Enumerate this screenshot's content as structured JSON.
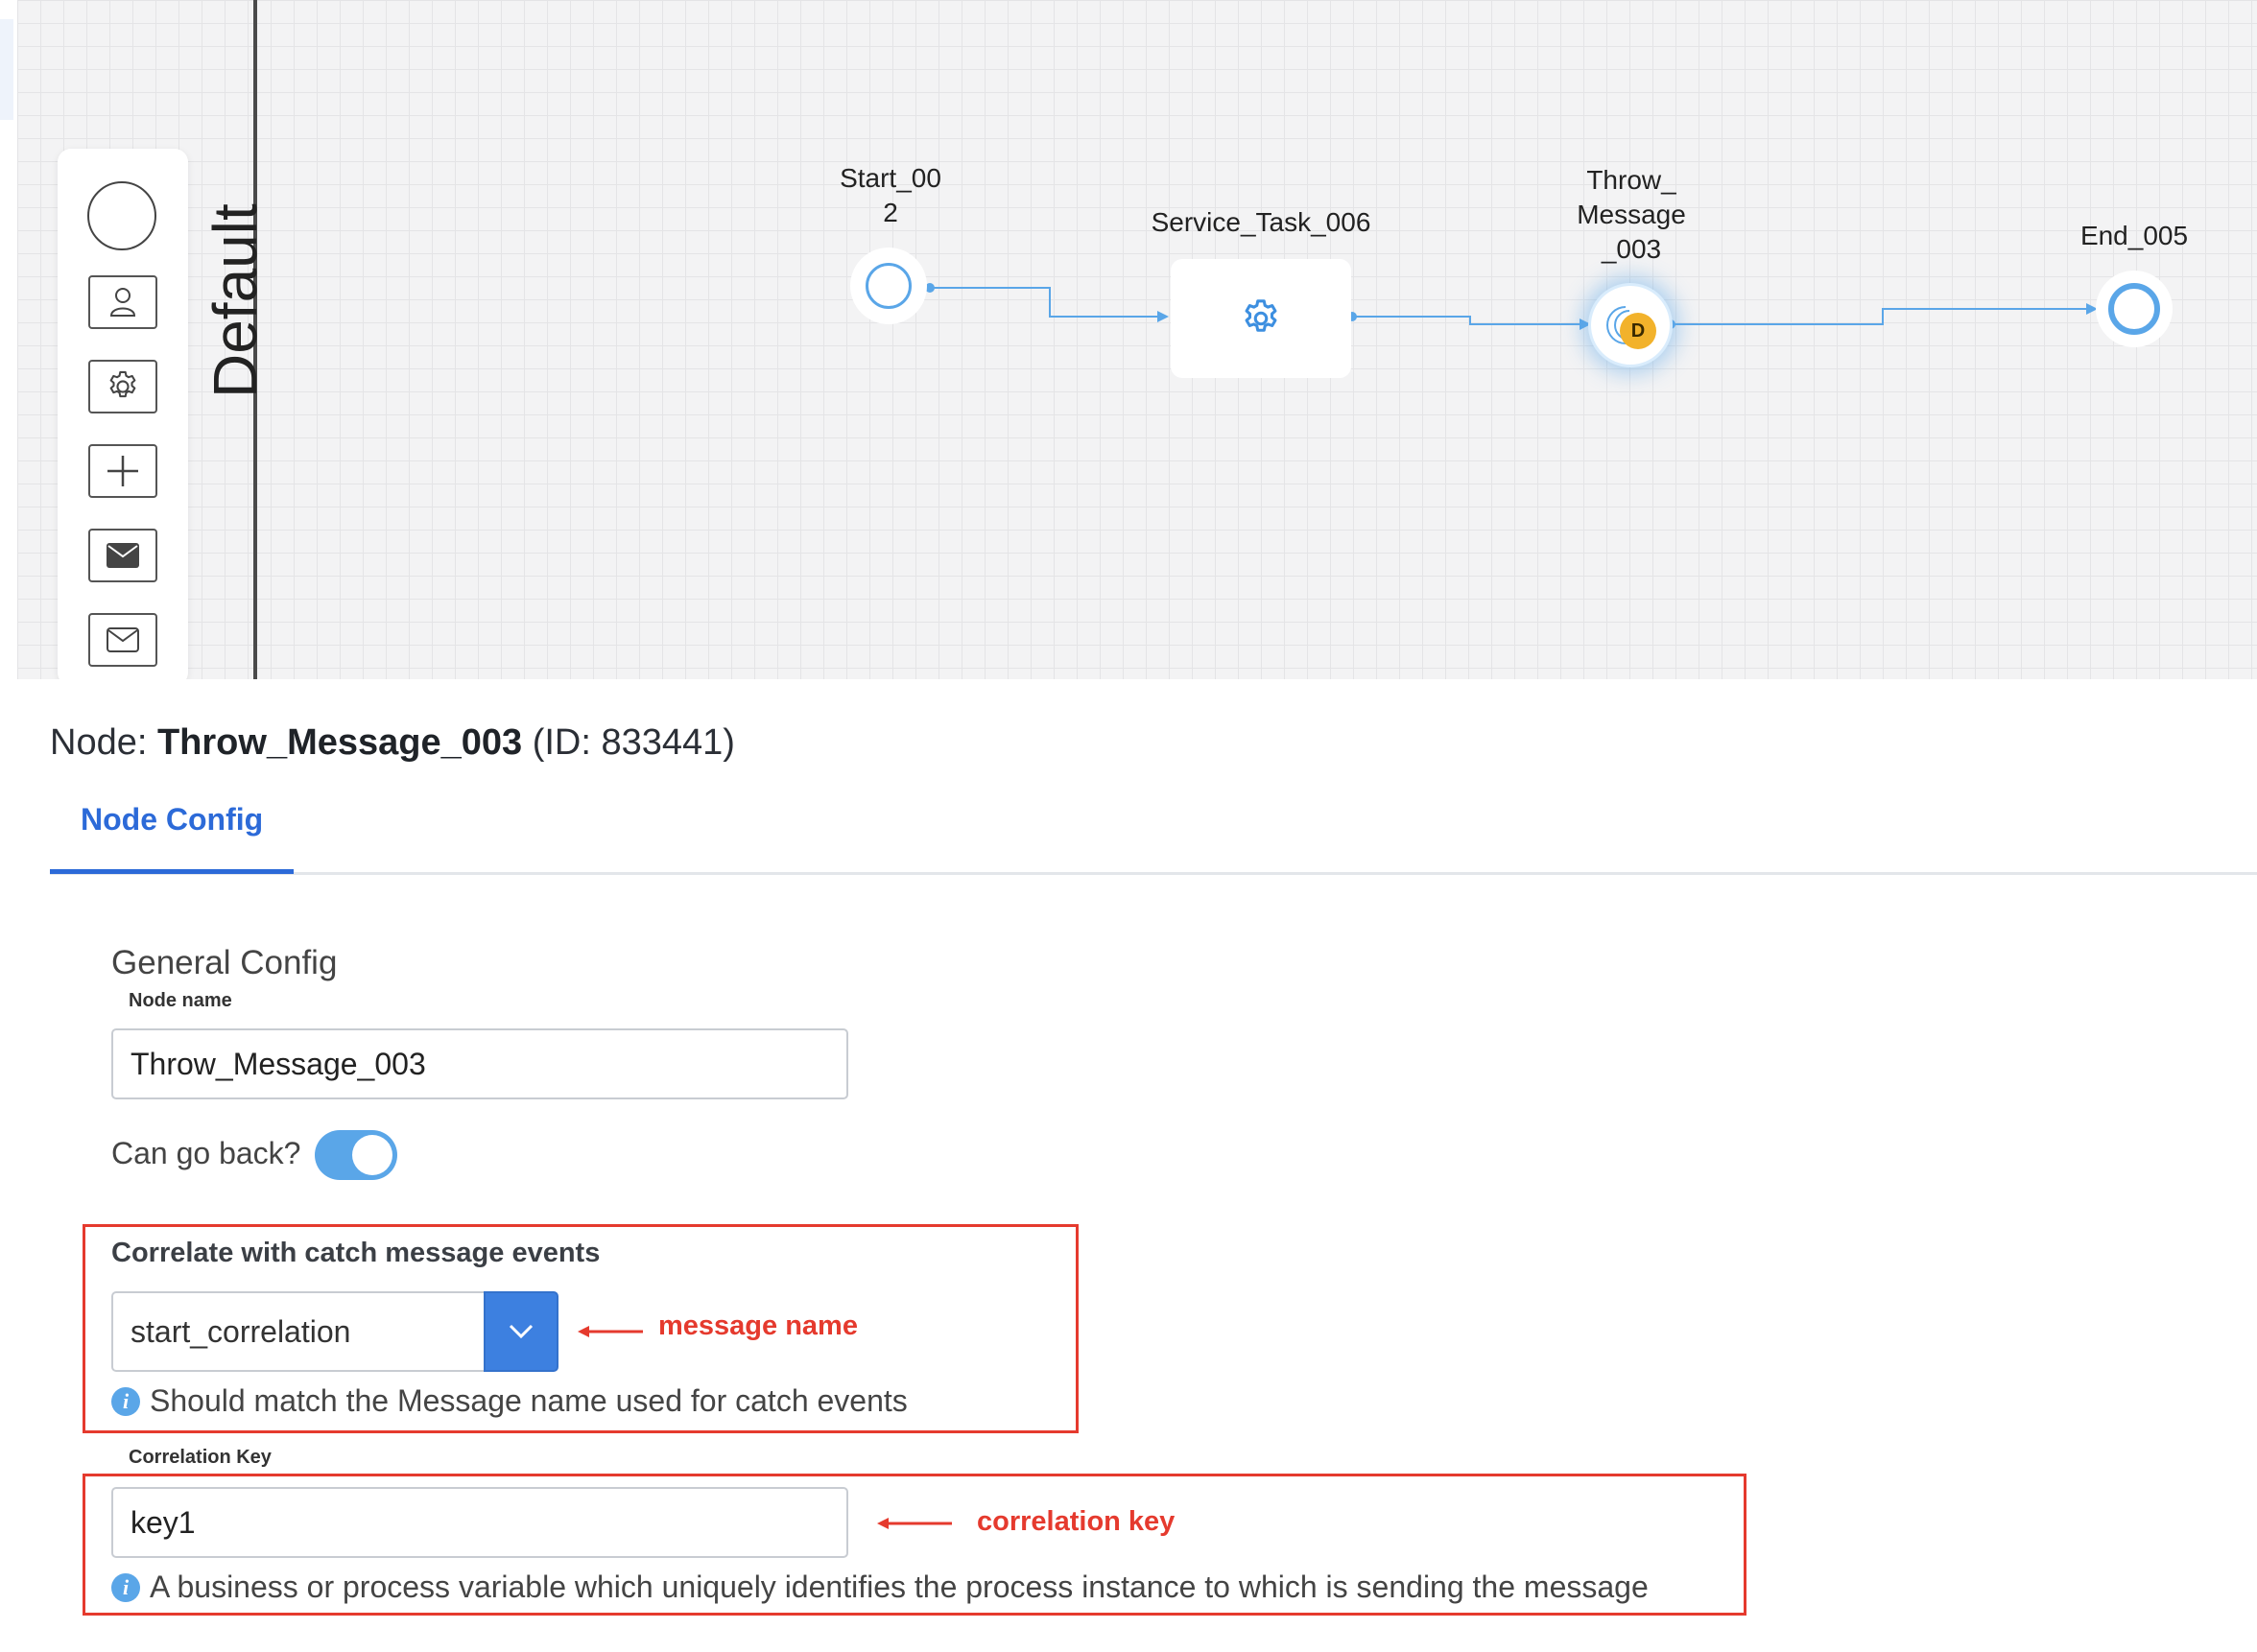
{
  "canvas": {
    "lane_label": "Default",
    "palette": [
      "start-event",
      "user-task",
      "service-task",
      "parallel-gateway",
      "message-throw",
      "message-catch"
    ],
    "nodes": {
      "start": "Start_00\n2",
      "service_task": "Service_Task_006",
      "throw_message": "Throw_\nMessage\n_003",
      "throw_badge": "D",
      "end": "End_005"
    }
  },
  "panel": {
    "title_prefix": "Node: ",
    "title_name": "Throw_Message_003",
    "title_suffix": " (ID: 833441)",
    "tab_label": "Node Config",
    "section_title": "General Config",
    "node_name_label": "Node name",
    "node_name_value": "Throw_Message_003",
    "can_go_back_label": "Can go back?",
    "can_go_back": true,
    "correlate_label": "Correlate with catch message events",
    "correlate_value": "start_correlation",
    "correlate_help": "Should match the Message name used for catch events",
    "correlation_key_label": "Correlation Key",
    "correlation_key_value": "key1",
    "correlation_key_help": "A business or process variable which uniquely identifies the process instance to which is sending the message"
  },
  "annotations": {
    "message_name": "message name",
    "correlation_key": "correlation key"
  },
  "colors": {
    "accent_blue": "#5aa6e8",
    "tab_blue": "#2c6ad8",
    "annotation_red": "#e53a2e",
    "badge_orange": "#f2b22b"
  }
}
